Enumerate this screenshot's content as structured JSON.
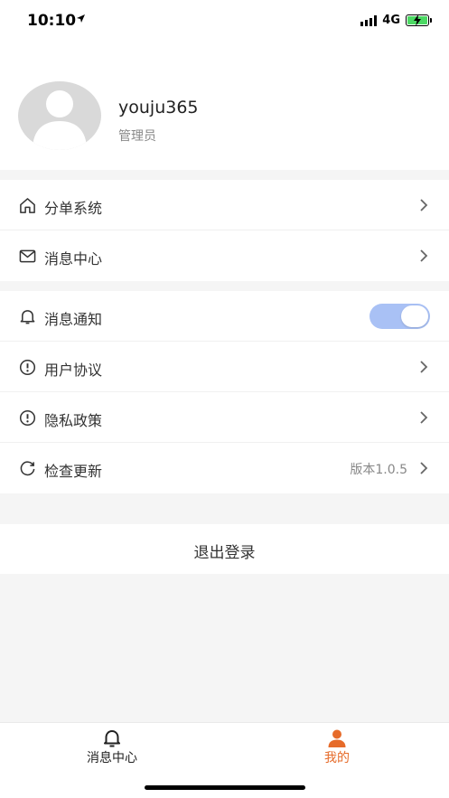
{
  "status_bar": {
    "time": "10:10",
    "network": "4G",
    "battery_color": "#4cd964"
  },
  "profile": {
    "username": "youju365",
    "role": "管理员"
  },
  "menu_group_1": [
    {
      "label": "分单系统",
      "icon": "home-icon"
    },
    {
      "label": "消息中心",
      "icon": "mail-icon"
    }
  ],
  "menu_group_2": [
    {
      "label": "消息通知",
      "icon": "bell-icon",
      "toggle_on": true
    },
    {
      "label": "用户协议",
      "icon": "info-icon"
    },
    {
      "label": "隐私政策",
      "icon": "info-icon"
    },
    {
      "label": "检查更新",
      "icon": "refresh-icon",
      "value": "版本1.0.5"
    }
  ],
  "logout_label": "退出登录",
  "tab_bar": {
    "tabs": [
      {
        "label": "消息中心",
        "icon": "bell-icon",
        "active": false
      },
      {
        "label": "我的",
        "icon": "person-icon",
        "active": true
      }
    ],
    "active_color": "#e66b2a"
  },
  "colors": {
    "toggle_on": "#a9c1f5",
    "background": "#f5f5f5"
  }
}
